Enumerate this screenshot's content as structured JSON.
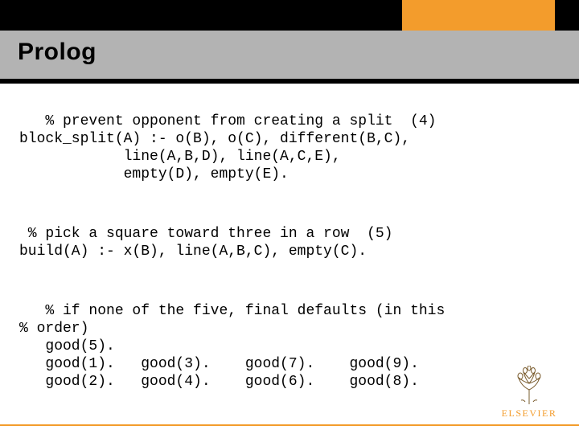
{
  "header": {
    "title": "Prolog"
  },
  "code": {
    "block1": "   % prevent opponent from creating a split  (4)\nblock_split(A) :- o(B), o(C), different(B,C),\n            line(A,B,D), line(A,C,E),\n            empty(D), empty(E).",
    "block2": " % pick a square toward three in a row  (5)\nbuild(A) :- x(B), line(A,B,C), empty(C).",
    "block3": "   % if none of the five, final defaults (in this\n% order)\n   good(5).\n   good(1).   good(3).    good(7).    good(9).\n   good(2).   good(4).    good(6).    good(8)."
  },
  "footer": {
    "publisher": "ELSEVIER"
  }
}
